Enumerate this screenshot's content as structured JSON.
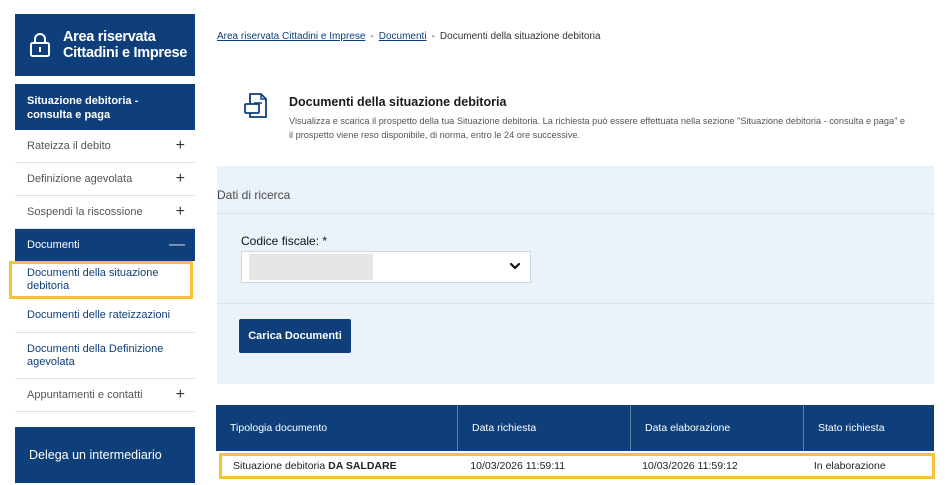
{
  "sidebar": {
    "area_title_line1": "Area riservata",
    "area_title_line2": "Cittadini e Imprese",
    "section_line1": "Situazione debitoria -",
    "section_line2": "consulta e paga",
    "items": [
      {
        "label": "Rateizza il debito",
        "plus": "+"
      },
      {
        "label": "Definizione agevolata",
        "plus": "+"
      },
      {
        "label": "Sospendi la riscossione",
        "plus": "+"
      }
    ],
    "documenti": {
      "label": "Documenti",
      "toggle": "—"
    },
    "sub_items": [
      {
        "line1": "Documenti della situazione",
        "line2": "debitoria"
      },
      {
        "line1": "Documenti delle rateizzazioni",
        "line2": ""
      },
      {
        "line1": "Documenti della Definizione",
        "line2": "agevolata"
      }
    ],
    "appuntamenti": {
      "label": "Appuntamenti e contatti",
      "plus": "+"
    },
    "delega": "Delega un intermediario"
  },
  "breadcrumb": {
    "item1": "Area riservata Cittadini e Imprese",
    "item2": "Documenti",
    "current": "Documenti della situazione debitoria",
    "sep": "-"
  },
  "intro": {
    "title": "Documenti della situazione debitoria",
    "description": "Visualizza e scarica il prospetto della tua Situazione debitoria. La richiesta può essere effettuata nella sezione \"Situazione debitoria - consulta e paga\" e il prospetto viene reso disponibile, di norma, entro le 24 ore successive."
  },
  "search": {
    "panel_label": "Dati di ricerca",
    "codice_fiscale_label": "Codice fiscale: *",
    "button_label": "Carica Documenti"
  },
  "table": {
    "headers": [
      "Tipologia documento",
      "Data richiesta",
      "Data elaborazione",
      "Stato richiesta"
    ],
    "rows": [
      {
        "tipologia_prefix": "Situazione debitoria ",
        "tipologia_bold": "DA SALDARE",
        "data_richiesta": "10/03/2026 11:59:11",
        "data_elaborazione": "10/03/2026 11:59:12",
        "stato": "In elaborazione"
      }
    ]
  },
  "colors": {
    "primary": "#0e3f7a",
    "highlight": "#f5c23a",
    "panel": "#eaf2fa"
  }
}
